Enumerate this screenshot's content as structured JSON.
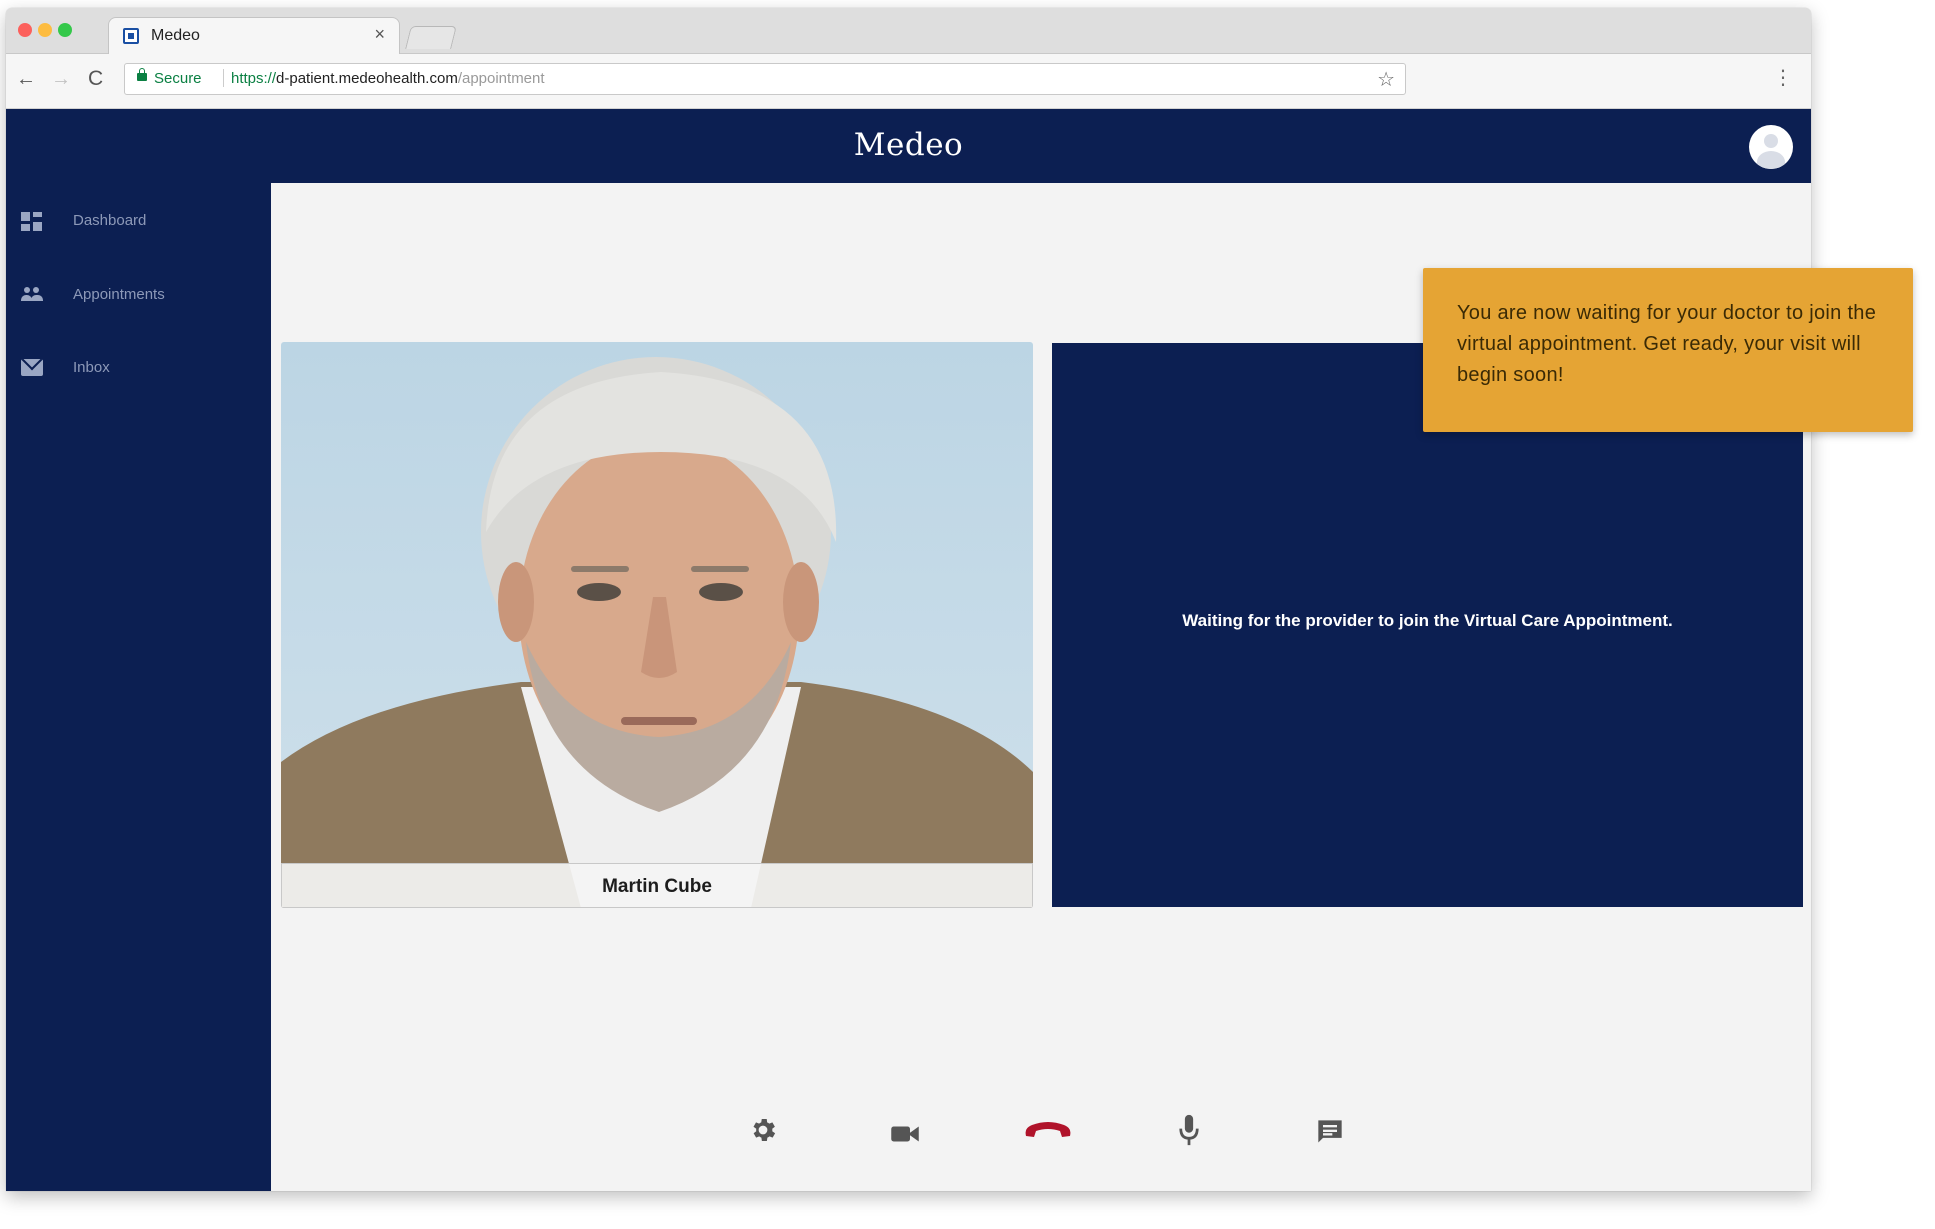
{
  "browser": {
    "tab_title": "Medeo",
    "tab_close": "×",
    "secure_label": "Secure",
    "url_scheme": "https://",
    "url_host": "d-patient.medeohealth.com",
    "url_path": "/appointment",
    "star_icon": "☆",
    "menu_icon": "⋮",
    "back_icon": "←",
    "forward_icon": "→",
    "reload_icon": "C"
  },
  "app": {
    "title": "Medeo",
    "brand_color": "#0c1f52"
  },
  "sidebar": {
    "items": [
      {
        "label": "Dashboard",
        "icon": "dashboard-icon"
      },
      {
        "label": "Appointments",
        "icon": "people-icon"
      },
      {
        "label": "Inbox",
        "icon": "mail-icon"
      }
    ]
  },
  "video": {
    "local_name": "Martin Cube",
    "remote_status": "Waiting for the provider to join the Virtual Care Appointment."
  },
  "controls": [
    {
      "name": "settings",
      "icon": "gear-icon"
    },
    {
      "name": "camera",
      "icon": "video-camera-icon"
    },
    {
      "name": "hang-up",
      "icon": "hang-up-phone-icon",
      "color": "#b0132a"
    },
    {
      "name": "microphone",
      "icon": "microphone-icon"
    },
    {
      "name": "chat",
      "icon": "chat-icon"
    }
  ],
  "callout": {
    "text": "You are now waiting for your doctor to join the virtual appointment. Get ready, your visit will begin soon!",
    "color": "#e5a434"
  }
}
